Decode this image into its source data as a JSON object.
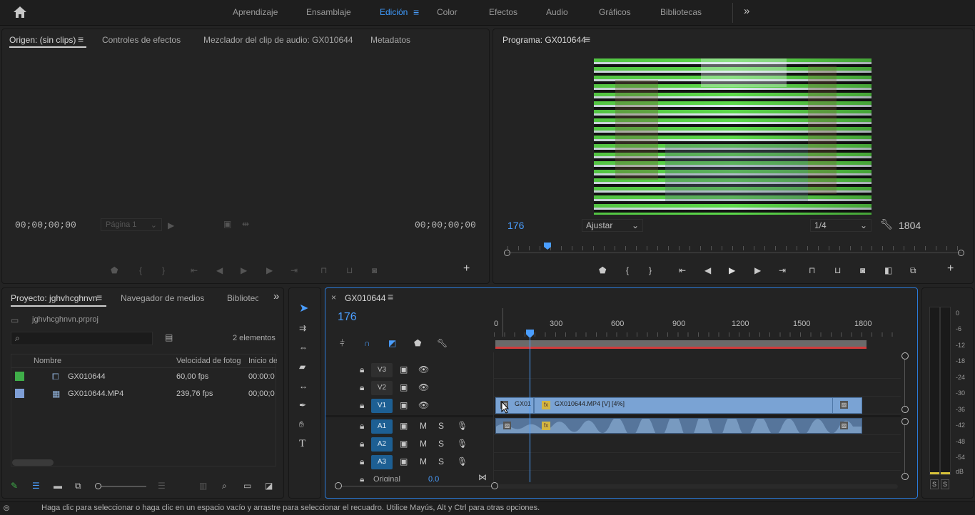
{
  "workspaces": [
    "Aprendizaje",
    "Ensamblaje",
    "Edición",
    "Color",
    "Efectos",
    "Audio",
    "Gráficos",
    "Bibliotecas"
  ],
  "active_workspace": "Edición",
  "source_panel": {
    "tabs": [
      "Origen: (sin clips)",
      "Controles de efectos",
      "Mezclador del clip de audio: GX010644",
      "Metadatos"
    ],
    "timecode_left": "00;00;00;00",
    "timecode_right": "00;00;00;00",
    "page_select": "Página 1"
  },
  "program_panel": {
    "title": "Programa: GX010644",
    "playhead": "176",
    "fit": "Ajustar",
    "quality": "1/4",
    "duration": "1804"
  },
  "project_panel": {
    "tabs": [
      "Proyecto: jghvhcghnvn",
      "Navegador de medios",
      "Bibliotec"
    ],
    "file": "jghvhcghnvn.prproj",
    "search_placeholder": "",
    "count": "2 elementos",
    "columns": [
      "Nombre",
      "Velocidad de fotog",
      "Inicio de"
    ],
    "items": [
      {
        "name": "GX010644",
        "rate": "60,00 fps",
        "start": "00:00:0",
        "color": "#3fae49"
      },
      {
        "name": "GX010644.MP4",
        "rate": "239,76 fps",
        "start": "00;00;0",
        "color": "#7f9fd6"
      }
    ]
  },
  "timeline": {
    "tab": "GX010644",
    "playhead": "176",
    "ruler": [
      "0",
      "300",
      "600",
      "900",
      "1200",
      "1500",
      "1800"
    ],
    "video_tracks": [
      "V3",
      "V2",
      "V1"
    ],
    "audio_tracks": [
      "A1",
      "A2",
      "A3"
    ],
    "master": {
      "label": "Original",
      "value": "0.0"
    },
    "clips": {
      "v1_short": "GX01",
      "v1_main": "GX010644.MP4 [V] [4%]"
    }
  },
  "meter": {
    "ticks": [
      "0",
      "-6",
      "-12",
      "-18",
      "-24",
      "-30",
      "-36",
      "-42",
      "-48",
      "-54",
      "dB"
    ],
    "solo": [
      "S",
      "S"
    ]
  },
  "status": "Haga clic para seleccionar o haga clic en un espacio vacío y arrastre para seleccionar el recuadro. Utilice Mayús, Alt y Ctrl para otras opciones."
}
